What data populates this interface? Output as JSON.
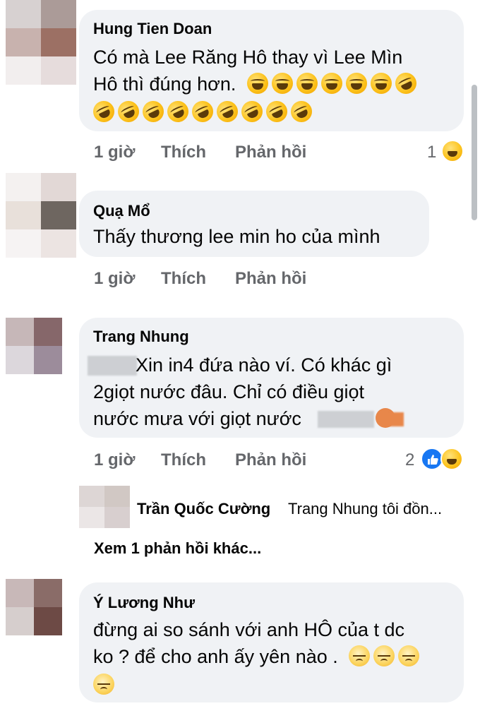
{
  "comments": [
    {
      "author": "Hung Tien Doan",
      "line1": "Có mà Lee Răng Hô thay vì Lee Mìn",
      "line2_text": "Hô thì đúng hơn.",
      "time": "1 giờ",
      "like_label": "Thích",
      "reply_label": "Phản hồi",
      "reaction_count": "1",
      "reactions": [
        "haha-icon"
      ]
    },
    {
      "author": "Quạ Mổ",
      "line1": "Thấy thương lee min ho của mình",
      "time": "1 giờ",
      "like_label": "Thích",
      "reply_label": "Phản hồi"
    },
    {
      "author": "Trang Nhung",
      "line1": "Xin in4 đứa nào ví. Có khác gì",
      "line2": "2giọt nước đâu. Chỉ có điều giọt",
      "line3": "nước mưa với giọt nước",
      "time": "1 giờ",
      "like_label": "Thích",
      "reply_label": "Phản hồi",
      "reaction_count": "2",
      "reactions": [
        "like-icon",
        "haha-icon"
      ],
      "reply": {
        "author": "Trần Quốc Cường",
        "text": "Trang Nhung tôi đồn...",
        "more_label": "Xem 1 phản hồi khác..."
      }
    },
    {
      "author": "Ý Lương Như",
      "line1": "đừng ai so sánh với anh HÔ của t dc",
      "line2": "ko ? để cho anh ấy yên nào .",
      "emoji": "steam-face-icon"
    }
  ],
  "colors": {
    "bubble": "#f0f2f5",
    "meta_text": "#65676b",
    "like_blue": "#1877f2",
    "emoji_yellow": "#fcc21b"
  }
}
